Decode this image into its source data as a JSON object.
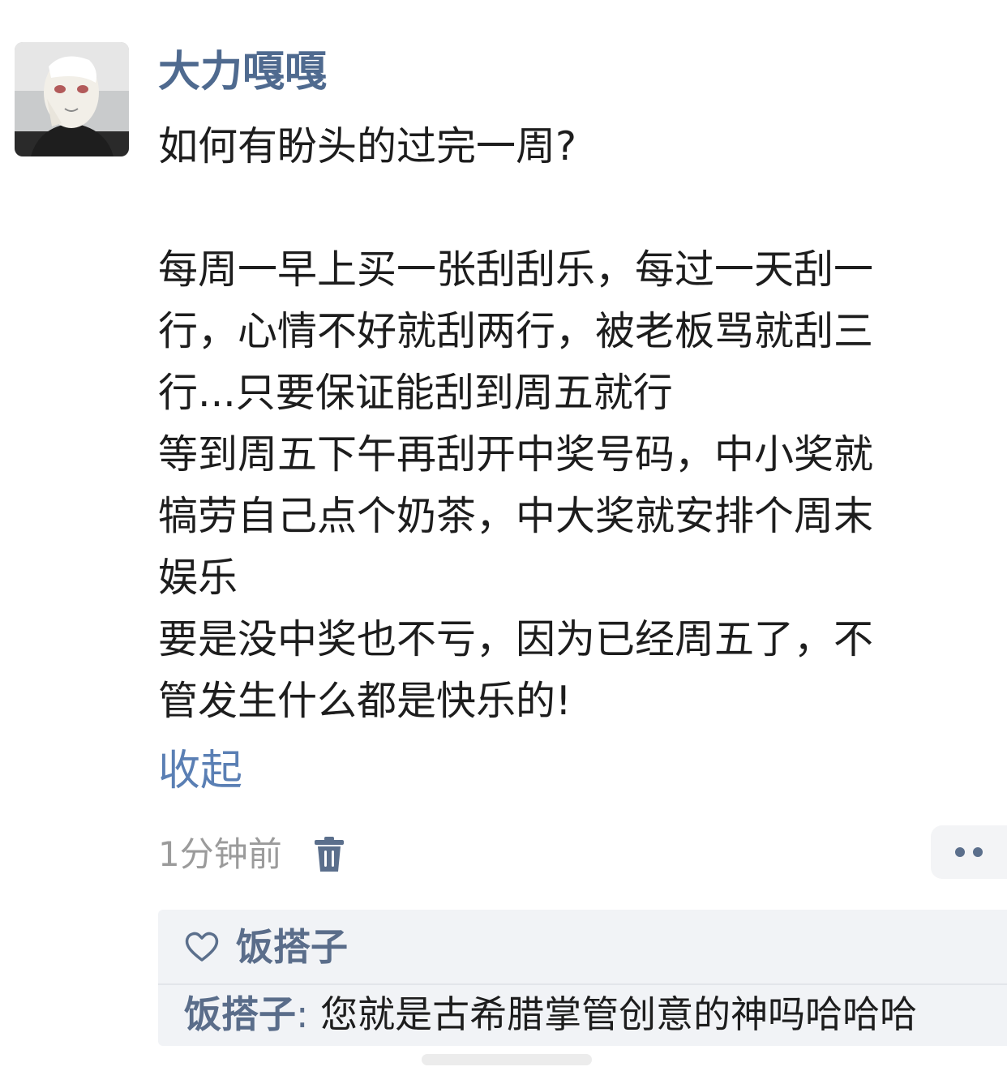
{
  "post": {
    "username": "大力嘎嘎",
    "lines": [
      "如何有盼头的过完一周?",
      "",
      "每周一早上买一张刮刮乐，每过一天刮一",
      "行，心情不好就刮两行，被老板骂就刮三",
      "行...只要保证能刮到周五就行",
      "等到周五下午再刮开中奖号码，中小奖就",
      "犒劳自己点个奶茶，中大奖就安排个周末",
      "娱乐",
      "要是没中奖也不亏，因为已经周五了，不",
      "管发生什么都是快乐的!"
    ],
    "collapse_label": "收起",
    "timestamp": "1分钟前"
  },
  "icons": {
    "avatar": "avatar-photo",
    "delete": "trash-icon",
    "more": "more-dots-icon",
    "like": "heart-outline-icon"
  },
  "reply_box": {
    "liker_name": "饭搭子",
    "reply_author": "饭搭子",
    "reply_separator": ": ",
    "reply_text": "您就是古希腊掌管创意的神吗哈哈哈"
  },
  "colors": {
    "username": "#4f6a8f",
    "link": "#5a7fb4",
    "timestamp": "#9b9b9b",
    "reply_box_bg": "#f1f3f6",
    "icon_accent": "#5b6f8c"
  }
}
